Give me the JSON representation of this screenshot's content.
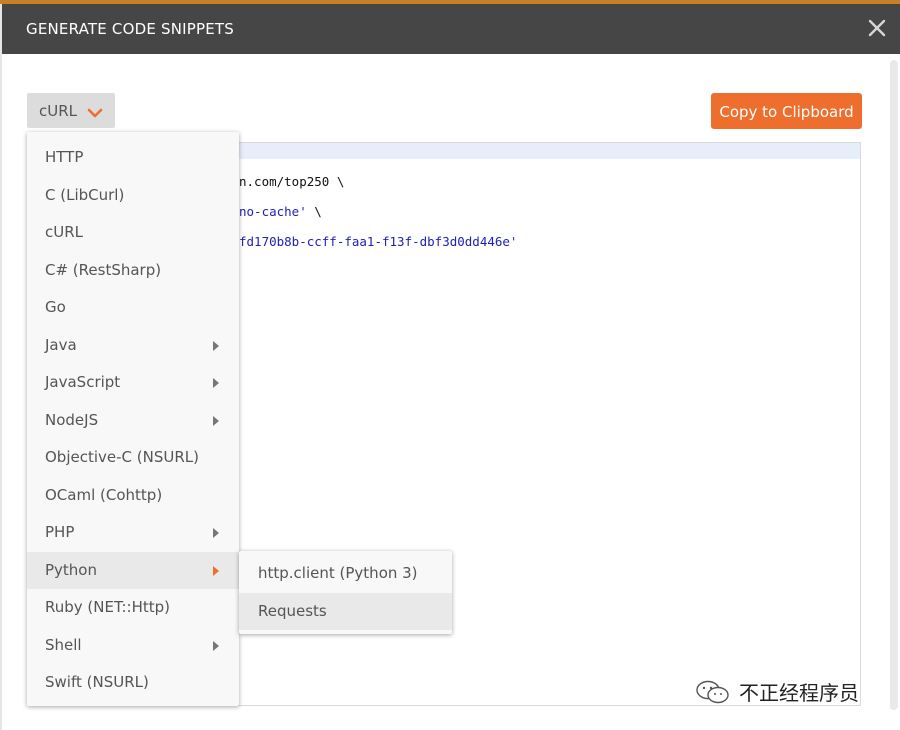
{
  "dialog": {
    "title": "GENERATE CODE SNIPPETS",
    "language_selected": "cURL",
    "copy_button": "Copy to Clipboard"
  },
  "code_lines": [
    {
      "plain": "n.com/top250 \\",
      "str": ""
    },
    {
      "plain": "",
      "str": "no-cache'",
      "after": " \\"
    },
    {
      "plain": "",
      "str": "fd170b8b-ccff-faa1-f13f-dbf3d0dd446e'",
      "after": ""
    }
  ],
  "language_menu": [
    {
      "label": "HTTP",
      "submenu": false
    },
    {
      "label": "C (LibCurl)",
      "submenu": false
    },
    {
      "label": "cURL",
      "submenu": false
    },
    {
      "label": "C# (RestSharp)",
      "submenu": false
    },
    {
      "label": "Go",
      "submenu": false
    },
    {
      "label": "Java",
      "submenu": true
    },
    {
      "label": "JavaScript",
      "submenu": true
    },
    {
      "label": "NodeJS",
      "submenu": true
    },
    {
      "label": "Objective-C (NSURL)",
      "submenu": false
    },
    {
      "label": "OCaml (Cohttp)",
      "submenu": false
    },
    {
      "label": "PHP",
      "submenu": true
    },
    {
      "label": "Python",
      "submenu": true,
      "active": true
    },
    {
      "label": "Ruby (NET::Http)",
      "submenu": false
    },
    {
      "label": "Shell",
      "submenu": true
    },
    {
      "label": "Swift (NSURL)",
      "submenu": false
    }
  ],
  "python_submenu": [
    {
      "label": "http.client (Python 3)"
    },
    {
      "label": "Requests",
      "active": true
    }
  ],
  "watermark": {
    "text": "不正经程序员",
    "icon": "wechat-icon"
  },
  "colors": {
    "header": "#464646",
    "accent": "#ee6e2e",
    "code_string": "#2020b8"
  }
}
